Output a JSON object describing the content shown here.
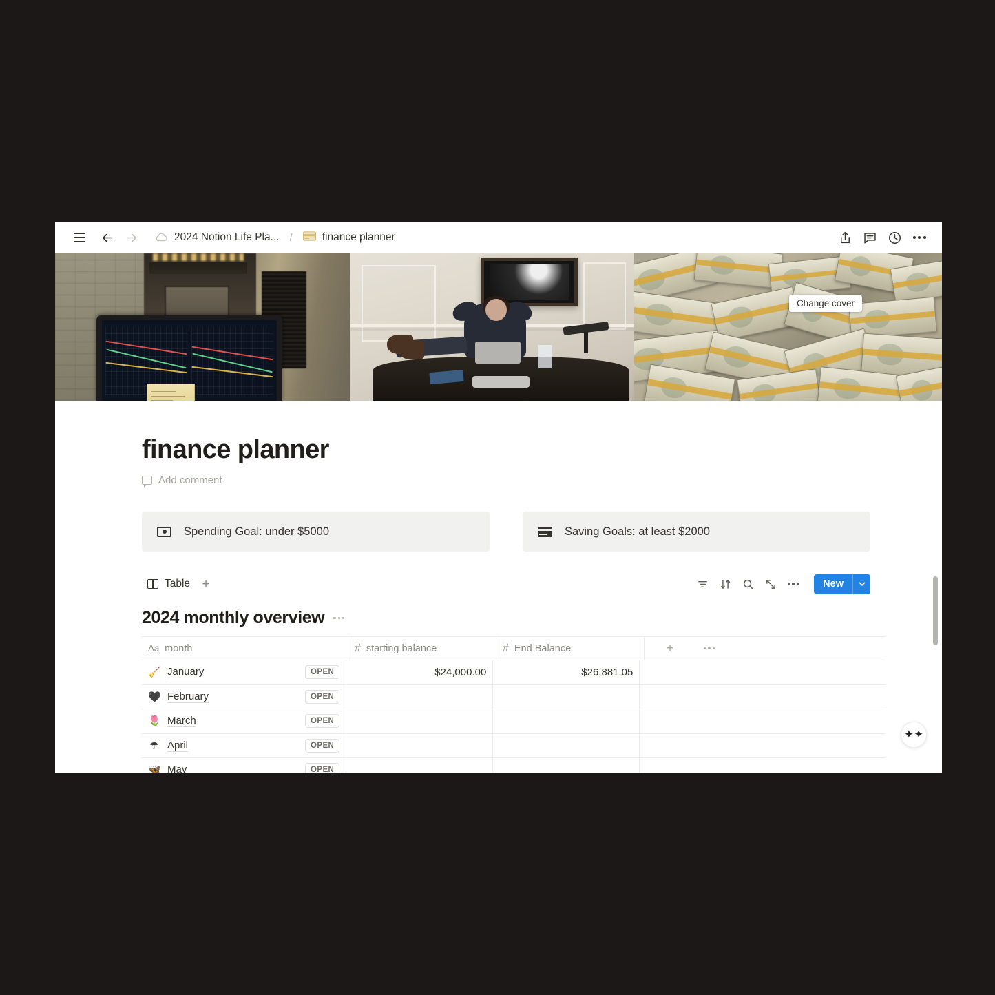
{
  "window": {
    "topbar": {
      "menu_icon": "hamburger-icon",
      "back_icon": "arrow-left-icon",
      "forward_icon": "arrow-right-icon",
      "breadcrumb": {
        "parent_label": "2024 Notion Life Pla...",
        "parent_icon": "cloud-icon",
        "separator": "/",
        "current_label": "finance planner",
        "current_icon": "credit-card-icon"
      },
      "actions": [
        {
          "name": "share-icon",
          "label": "Share"
        },
        {
          "name": "comment-icon",
          "label": "Comments"
        },
        {
          "name": "history-icon",
          "label": "Updates"
        },
        {
          "name": "more-options-icon",
          "label": "More"
        }
      ]
    }
  },
  "cover": {
    "tooltip_label": "Change cover",
    "panes": [
      {
        "name": "laptop-trading-charts-coffee-shop"
      },
      {
        "name": "woman-relaxing-at-desk"
      },
      {
        "name": "stacks-of-cash"
      }
    ]
  },
  "page": {
    "title": "finance planner",
    "add_comment_label": "Add comment"
  },
  "callouts": [
    {
      "icon": "money-icon",
      "text": "Spending Goal: under $5000"
    },
    {
      "icon": "credit-card-icon",
      "text": "Saving Goals: at least $2000"
    }
  ],
  "db_toolbar": {
    "view_label": "Table",
    "view_icon": "table-grid-icon",
    "add_view_icon": "plus-icon",
    "actions": [
      {
        "name": "filter-icon",
        "label": "Filter"
      },
      {
        "name": "sort-icon",
        "label": "Sort"
      },
      {
        "name": "search-icon",
        "label": "Search"
      },
      {
        "name": "expand-icon",
        "label": "Expand"
      },
      {
        "name": "more-options-icon",
        "label": "More"
      }
    ],
    "new_label": "New",
    "new_caret_icon": "chevron-down-icon",
    "accent_color": "#2383e2"
  },
  "database": {
    "title": "2024 monthly overview",
    "columns": [
      {
        "label": "month",
        "type_icon": "Aa"
      },
      {
        "label": "starting balance",
        "type_icon": "#"
      },
      {
        "label": "End Balance",
        "type_icon": "#"
      }
    ],
    "open_label": "OPEN",
    "rows": [
      {
        "emoji": "🧹",
        "month": "January",
        "starting_balance": "$24,000.00",
        "end_balance": "$26,881.05"
      },
      {
        "emoji": "🖤",
        "month": "February",
        "starting_balance": "",
        "end_balance": ""
      },
      {
        "emoji": "🌷",
        "month": "March",
        "starting_balance": "",
        "end_balance": ""
      },
      {
        "emoji": "☂",
        "month": "April",
        "starting_balance": "",
        "end_balance": ""
      },
      {
        "emoji": "🦋",
        "month": "May",
        "starting_balance": "",
        "end_balance": ""
      }
    ]
  },
  "floating": {
    "ai_icon": "ai-sparkle-icon"
  }
}
